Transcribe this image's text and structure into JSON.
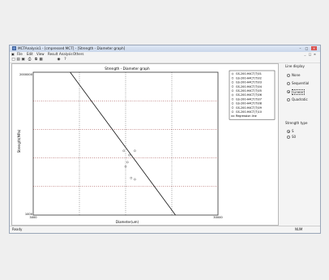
{
  "window": {
    "title": "MCTAnalysis1 - [cmpressed MCT] - [Strength - Diameter graph]",
    "min": "–",
    "max": "□",
    "close": "×",
    "mdi_min": "_",
    "mdi_max": "□",
    "mdi_close": "×"
  },
  "menu": [
    "File",
    "Edit",
    "View",
    "Result",
    "Analysis",
    "Others"
  ],
  "toolbar_icons": [
    "new-icon",
    "open-icon",
    "save-icon",
    "print-icon",
    "copy-icon",
    "paste-icon",
    "chart-icon",
    "help-icon"
  ],
  "toolbar_glyphs": [
    "□",
    "▤",
    "▣",
    "⎙",
    "⧉",
    "▦",
    "◉",
    "?"
  ],
  "chart_data": {
    "type": "scatter",
    "title": "Strength - Diameter graph",
    "xlabel": "Diameter(um)",
    "ylabel": "Strength(MPa)",
    "ylabel_short": "Strength(MPa)",
    "xlim_labels": [
      "3000",
      "30000"
    ],
    "ylim_labels": [
      "1000",
      "2000000"
    ],
    "log_scale": true,
    "grid": true,
    "legend_position": "right",
    "series": [
      {
        "name": "GS-200-H4CT(T)01",
        "points": [
          [
            0.49,
            0.55
          ],
          [
            0.52,
            0.58
          ]
        ]
      },
      {
        "name": "GS-200-H4CT(T)02",
        "points": [
          [
            0.55,
            0.55
          ]
        ]
      },
      {
        "name": "GS-200-H4CT(T)03",
        "points": [
          [
            0.51,
            0.63
          ]
        ]
      },
      {
        "name": "GS-200-H4CT(T)04",
        "points": [
          [
            0.53,
            0.74
          ],
          [
            0.55,
            0.75
          ]
        ]
      },
      {
        "name": "GS-200-H4CT(T)05",
        "points": [
          [
            0.5,
            0.66
          ]
        ]
      },
      {
        "name": "GS-200-H4CT(T)06",
        "points": []
      },
      {
        "name": "GS-200-H4CT(T)07",
        "points": []
      },
      {
        "name": "GS-200-H4CT(T)08",
        "points": []
      },
      {
        "name": "GS-200-H4CT(T)09",
        "points": []
      },
      {
        "name": "GS-200-H4CT(T)10",
        "points": []
      }
    ],
    "line": {
      "name": "Regression line",
      "from": [
        0.2,
        0.0
      ],
      "to": [
        0.77,
        1.0
      ]
    }
  },
  "side_panel": {
    "line_display_label": "Line display",
    "line_options": [
      "None",
      "Sequential",
      "Linear",
      "Quadratic"
    ],
    "line_selected": 2,
    "strength_type_label": "Strength type",
    "strength_options": [
      "S",
      "S0"
    ],
    "strength_selected": 0
  },
  "status": {
    "left": "Ready",
    "right": "NUM"
  },
  "colors": {
    "titlebar": "#c9d6ea",
    "line": "#111111",
    "grid": "#444444",
    "point": "#666666"
  }
}
